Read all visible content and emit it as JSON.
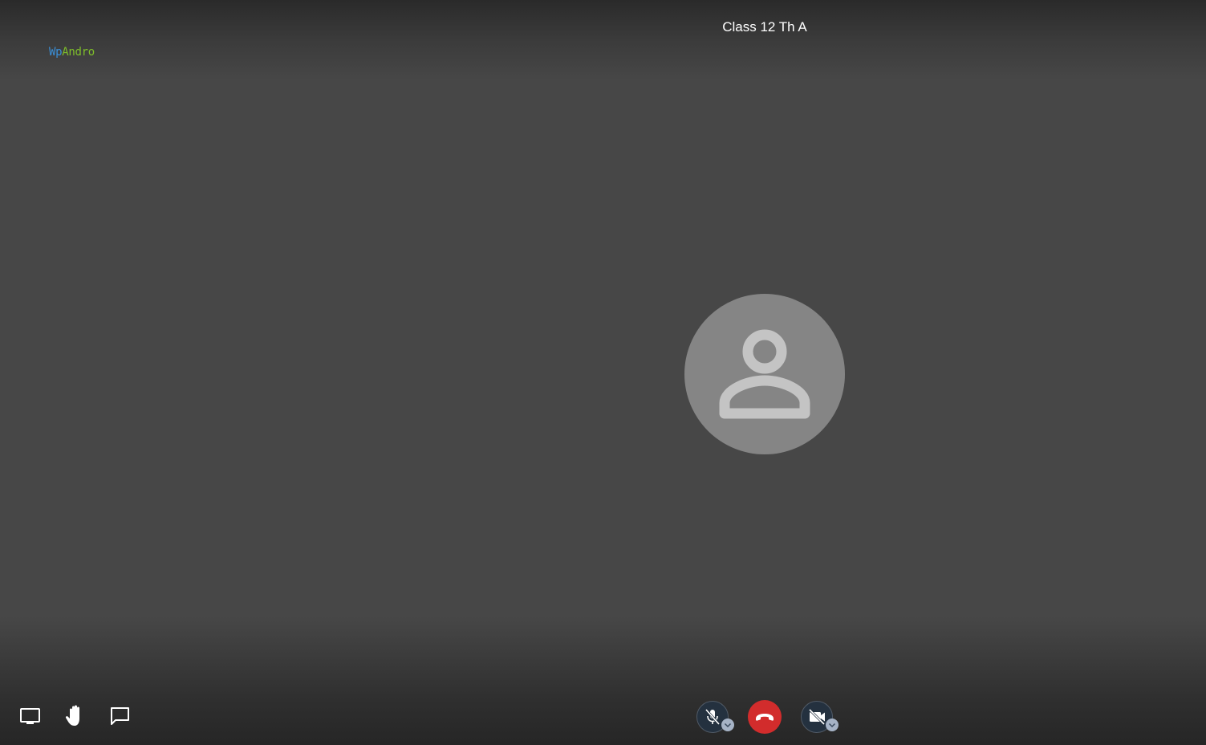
{
  "meeting": {
    "title": "Class 12 Th A"
  },
  "logo": {
    "part1": "Wp",
    "part2": "Andro",
    "colors": {
      "wp": "#3a8fd8",
      "andro": "#7fbf2a"
    }
  },
  "participant": {
    "avatar_icon": "person-icon",
    "avatar_color": "#858585"
  },
  "toolbar_left": [
    {
      "id": "share-screen",
      "icon": "desktop-icon"
    },
    {
      "id": "raise-hand",
      "icon": "hand-icon"
    },
    {
      "id": "chat",
      "icon": "chat-icon"
    }
  ],
  "toolbar_center": {
    "microphone": {
      "icon": "mic-off-icon",
      "state": "muted"
    },
    "hangup": {
      "icon": "phone-hangup-icon",
      "color": "#d22c2c"
    },
    "camera": {
      "icon": "video-off-icon",
      "state": "off"
    }
  },
  "colors": {
    "background": "#474747",
    "control_bg": "#24313f",
    "chevron_bg": "#a6b3c6"
  }
}
